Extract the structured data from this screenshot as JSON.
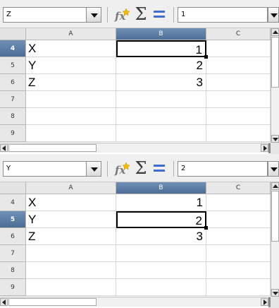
{
  "columns": [
    "A",
    "B",
    "C"
  ],
  "row_numbers": [
    "4",
    "5",
    "6",
    "7",
    "8",
    "9"
  ],
  "cells": {
    "A": [
      "X",
      "Y",
      "Z",
      "",
      "",
      ""
    ],
    "B": [
      "1",
      "2",
      "3",
      "",
      "",
      ""
    ]
  },
  "panes": [
    {
      "name_box": "Z",
      "formula_content": "1",
      "active_row": "4",
      "active_column": "B"
    },
    {
      "name_box": "Y",
      "formula_content": "2",
      "active_row": "5",
      "active_column": "B"
    }
  ],
  "icons": {
    "name_box_dropdown": "chevron-down-icon",
    "function_wizard": "function-wizard-icon",
    "sum": "sigma-icon",
    "formula": "equals-icon"
  },
  "colors": {
    "selected_header": "#5a7ba3",
    "equals_icon": "#3b6fcf"
  }
}
